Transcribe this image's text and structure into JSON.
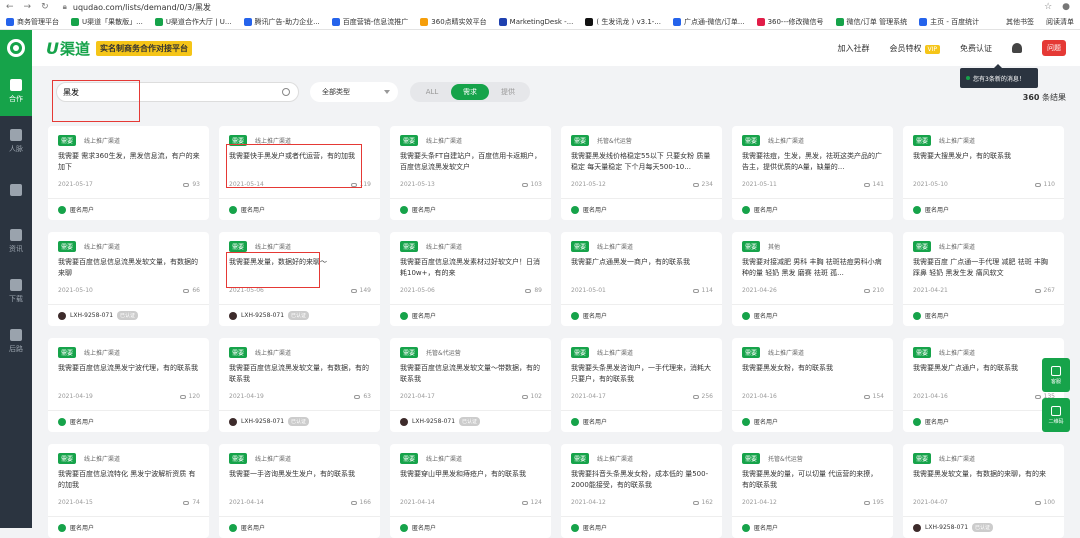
{
  "browser": {
    "url": "uqudao.com/lists/demand/0/3/黑发",
    "bookmarks": [
      "商务管理平台",
      "U渠道「果散版」...",
      "U渠道合作大厅 | U...",
      "腾讯广告-助力企业...",
      "百度营销-信息流推广",
      "360点睛实效平台",
      "MarketingDesk -...",
      "( 生发讯龙 ) v3.1-...",
      "广点通-微信/订单...",
      "360---修改微信号",
      "微信/订单 管理系统",
      "主页 - 百度统计"
    ],
    "bookmarks_right": [
      "其他书签",
      "阅读清单"
    ]
  },
  "sidebar": {
    "items": [
      {
        "label": "合作",
        "active": true
      },
      {
        "label": "人脉"
      },
      {
        "label": ""
      },
      {
        "label": "资讯"
      },
      {
        "label": "下载"
      },
      {
        "label": "后路"
      }
    ]
  },
  "header": {
    "brand_u": "U",
    "brand_name": "渠道",
    "tag": "实名制商务合作对接平台",
    "join": "加入社群",
    "member": "会员特权",
    "vip": "VIP",
    "free_cert": "免费认证",
    "avatar": "问题"
  },
  "notify": "您有3条新的消息！",
  "search": {
    "value": "黑发",
    "type": "全部类型",
    "seg": [
      "ALL",
      "需求",
      "提供"
    ],
    "count_num": "360",
    "count_label": "条结果"
  },
  "cards": [
    {
      "tag": "需要",
      "cat": "线上推广渠道",
      "desc": "我需要 需求360生发，黑发信息流，有户的来加下",
      "date": "2021-05-17",
      "views": "93",
      "user": "匿名用户"
    },
    {
      "tag": "需要",
      "cat": "线上推广渠道",
      "desc": "我需要快手黑发户或者代运营，有的加我",
      "date": "2021-05-14",
      "views": "119",
      "user": "匿名用户"
    },
    {
      "tag": "需要",
      "cat": "线上推广渠道",
      "desc": "我需要头条FT自建站户，百度信用卡返期户，百度信息流黑发软文户",
      "date": "2021-05-13",
      "views": "103",
      "user": "匿名用户"
    },
    {
      "tag": "需要",
      "cat": "托管&代运营",
      "desc": "我需要黑发线价格稳定55以下 只要女粉 质量稳定 每天量稳定 下个月每天500-10...",
      "date": "2021-05-12",
      "views": "234",
      "user": "匿名用户"
    },
    {
      "tag": "需要",
      "cat": "线上推广渠道",
      "desc": "我需要祛痘，生发，黑发，祛斑这类产品的广告主，提供优质的A量，缺量的...",
      "date": "2021-05-11",
      "views": "141",
      "user": "匿名用户"
    },
    {
      "tag": "需要",
      "cat": "线上推广渠道",
      "desc": "我需要大搜黑发户，有的联系我",
      "date": "2021-05-10",
      "views": "110",
      "user": "匿名用户"
    },
    {
      "tag": "需要",
      "cat": "线上推广渠道",
      "desc": "我需要百度信息信息流黑发软文量，有数据的来聊",
      "date": "2021-05-10",
      "views": "66",
      "user": "LXH-9258-071",
      "badge": "已认证"
    },
    {
      "tag": "需要",
      "cat": "线上推广渠道",
      "desc": "我需要黑发量，数据好的来聊～",
      "date": "2021-05-06",
      "views": "149",
      "user": "LXH-9258-071",
      "badge": "已认证"
    },
    {
      "tag": "需要",
      "cat": "线上推广渠道",
      "desc": "我需要百度信息流黑发素材过好软文户！日消耗10w+，有的来",
      "date": "2021-05-06",
      "views": "89",
      "user": "匿名用户"
    },
    {
      "tag": "需要",
      "cat": "线上推广渠道",
      "desc": "我需要广点通黑发一商户，有的联系我",
      "date": "2021-05-01",
      "views": "114",
      "user": "匿名用户"
    },
    {
      "tag": "需要",
      "cat": "其他",
      "desc": "我需要对接减肥 男科 丰胸 祛斑祛痘男科小病种的量 轻奶 黑发 磨赛 祛斑 孤...",
      "date": "2021-04-26",
      "views": "210",
      "user": "匿名用户"
    },
    {
      "tag": "需要",
      "cat": "线上推广渠道",
      "desc": "我需要百度 广点通一手代理 减肥 祛斑 丰胸 踩鼻 轻奶 黑发生发 痛风软文",
      "date": "2021-04-21",
      "views": "267",
      "user": "匿名用户"
    },
    {
      "tag": "需要",
      "cat": "线上推广渠道",
      "desc": "我需要百度信息流黑发宁波代理，有的联系我",
      "date": "2021-04-19",
      "views": "120",
      "user": "匿名用户"
    },
    {
      "tag": "需要",
      "cat": "线上推广渠道",
      "desc": "我需要百度信息流黑发软文量，有数据，有的联系我",
      "date": "2021-04-19",
      "views": "63",
      "user": "LXH-9258-071",
      "badge": "已认证"
    },
    {
      "tag": "需要",
      "cat": "托管&代运营",
      "desc": "我需要百度信息流黑发软文量～带数据，有的联系我",
      "date": "2021-04-17",
      "views": "102",
      "user": "LXH-9258-071",
      "badge": "已认证"
    },
    {
      "tag": "需要",
      "cat": "线上推广渠道",
      "desc": "我需要头条黑发咨询户，一手代理来，消耗大只要户，有的联系我",
      "date": "2021-04-17",
      "views": "256",
      "user": "匿名用户"
    },
    {
      "tag": "需要",
      "cat": "线上推广渠道",
      "desc": "我需要黑发女粉，有的联系我",
      "date": "2021-04-16",
      "views": "154",
      "user": "匿名用户"
    },
    {
      "tag": "需要",
      "cat": "线上推广渠道",
      "desc": "我需要黑发广点通户，有的联系我",
      "date": "2021-04-16",
      "views": "135",
      "user": "匿名用户"
    },
    {
      "tag": "需要",
      "cat": "线上推广渠道",
      "desc": "我需要百度信息流特化 黑发宁波解析资质 有的加我",
      "date": "2021-04-15",
      "views": "74",
      "user": "匿名用户"
    },
    {
      "tag": "需要",
      "cat": "线上推广渠道",
      "desc": "我需要一手咨询黑发生发户，有的联系我",
      "date": "2021-04-14",
      "views": "166",
      "user": "匿名用户"
    },
    {
      "tag": "需要",
      "cat": "线上推广渠道",
      "desc": "我需要穿山甲黑发和痔疮户，有的联系我",
      "date": "2021-04-14",
      "views": "124",
      "user": "匿名用户"
    },
    {
      "tag": "需要",
      "cat": "线上推广渠道",
      "desc": "我需要抖音头条黑发女粉，成本低的 量500-2000能接受，有的联系我",
      "date": "2021-04-12",
      "views": "162",
      "user": "匿名用户"
    },
    {
      "tag": "需要",
      "cat": "托管&代运营",
      "desc": "我需要黑发的量，可以切量 代运营的来撩，有的联系我",
      "date": "2021-04-12",
      "views": "195",
      "user": "匿名用户"
    },
    {
      "tag": "需要",
      "cat": "线上推广渠道",
      "desc": "我需要黑发软文量，有数据的来聊，有的来",
      "date": "2021-04-07",
      "views": "100",
      "user": "LXH-9258-071",
      "badge": "已认证"
    }
  ],
  "float": [
    {
      "label": "客服"
    },
    {
      "label": "二维码"
    }
  ]
}
